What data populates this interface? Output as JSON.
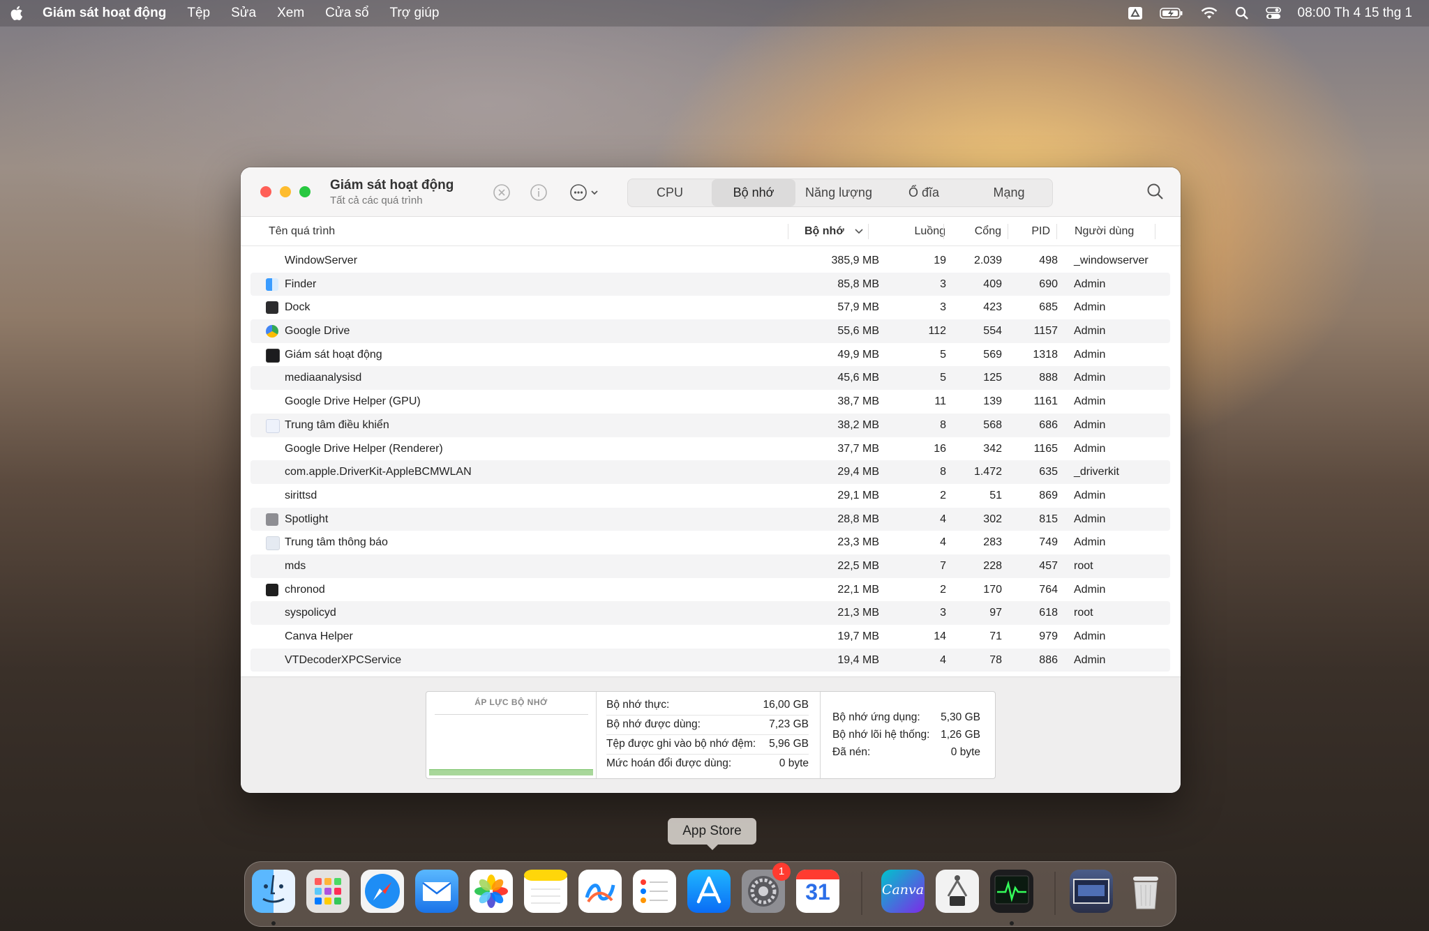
{
  "menubar": {
    "app_name": "Giám sát hoạt động",
    "menus": [
      "Tệp",
      "Sửa",
      "Xem",
      "Cửa sổ",
      "Trợ giúp"
    ],
    "clock": "08:00 Th 4 15 thg 1"
  },
  "window": {
    "title": "Giám sát hoạt động",
    "subtitle": "Tất cả các quá trình",
    "tabs": [
      "CPU",
      "Bộ nhớ",
      "Năng lượng",
      "Ổ đĩa",
      "Mạng"
    ],
    "active_tab": "Bộ nhớ",
    "columns": {
      "name": "Tên quá trình",
      "memory": "Bộ nhớ",
      "threads": "Luồng",
      "ports": "Cổng",
      "pid": "PID",
      "user": "Người dùng"
    },
    "processes": [
      {
        "name": "WindowServer",
        "memory": "385,9 MB",
        "threads": "19",
        "ports": "2.039",
        "pid": "498",
        "user": "_windowserver",
        "icon": ""
      },
      {
        "name": "Finder",
        "memory": "85,8 MB",
        "threads": "3",
        "ports": "409",
        "pid": "690",
        "user": "Admin",
        "icon": "finder"
      },
      {
        "name": "Dock",
        "memory": "57,9 MB",
        "threads": "3",
        "ports": "423",
        "pid": "685",
        "user": "Admin",
        "icon": "dock"
      },
      {
        "name": "Google Drive",
        "memory": "55,6 MB",
        "threads": "112",
        "ports": "554",
        "pid": "1157",
        "user": "Admin",
        "icon": "gdrive"
      },
      {
        "name": "Giám sát hoạt động",
        "memory": "49,9 MB",
        "threads": "5",
        "ports": "569",
        "pid": "1318",
        "user": "Admin",
        "icon": "activity"
      },
      {
        "name": "mediaanalysisd",
        "memory": "45,6 MB",
        "threads": "5",
        "ports": "125",
        "pid": "888",
        "user": "Admin",
        "icon": ""
      },
      {
        "name": "Google Drive Helper (GPU)",
        "memory": "38,7 MB",
        "threads": "11",
        "ports": "139",
        "pid": "1161",
        "user": "Admin",
        "icon": ""
      },
      {
        "name": "Trung tâm điều khiển",
        "memory": "38,2 MB",
        "threads": "8",
        "ports": "568",
        "pid": "686",
        "user": "Admin",
        "icon": "control"
      },
      {
        "name": "Google Drive Helper (Renderer)",
        "memory": "37,7 MB",
        "threads": "16",
        "ports": "342",
        "pid": "1165",
        "user": "Admin",
        "icon": ""
      },
      {
        "name": "com.apple.DriverKit-AppleBCMWLAN",
        "memory": "29,4 MB",
        "threads": "8",
        "ports": "1.472",
        "pid": "635",
        "user": "_driverkit",
        "icon": ""
      },
      {
        "name": "sirittsd",
        "memory": "29,1 MB",
        "threads": "2",
        "ports": "51",
        "pid": "869",
        "user": "Admin",
        "icon": ""
      },
      {
        "name": "Spotlight",
        "memory": "28,8 MB",
        "threads": "4",
        "ports": "302",
        "pid": "815",
        "user": "Admin",
        "icon": "spotlight"
      },
      {
        "name": "Trung tâm thông báo",
        "memory": "23,3 MB",
        "threads": "4",
        "ports": "283",
        "pid": "749",
        "user": "Admin",
        "icon": "notif"
      },
      {
        "name": "mds",
        "memory": "22,5 MB",
        "threads": "7",
        "ports": "228",
        "pid": "457",
        "user": "root",
        "icon": ""
      },
      {
        "name": "chronod",
        "memory": "22,1 MB",
        "threads": "2",
        "ports": "170",
        "pid": "764",
        "user": "Admin",
        "icon": "terminal"
      },
      {
        "name": "syspolicyd",
        "memory": "21,3 MB",
        "threads": "3",
        "ports": "97",
        "pid": "618",
        "user": "root",
        "icon": ""
      },
      {
        "name": "Canva Helper",
        "memory": "19,7 MB",
        "threads": "14",
        "ports": "71",
        "pid": "979",
        "user": "Admin",
        "icon": ""
      },
      {
        "name": "VTDecoderXPCService",
        "memory": "19,4 MB",
        "threads": "4",
        "ports": "78",
        "pid": "886",
        "user": "Admin",
        "icon": ""
      }
    ],
    "memory_panel": {
      "pressure_label": "ÁP LỰC BỘ NHỚ",
      "pressure_fraction": 0.1,
      "physical_label": "Bộ nhớ thực:",
      "physical_value": "16,00 GB",
      "used_label": "Bộ nhớ được dùng:",
      "used_value": "7,23 GB",
      "cached_label": "Tệp được ghi vào bộ nhớ đệm:",
      "cached_value": "5,96 GB",
      "swap_label": "Mức hoán đổi được dùng:",
      "swap_value": "0 byte",
      "app_label": "Bộ nhớ ứng dụng:",
      "app_value": "5,30 GB",
      "wired_label": "Bộ nhớ lõi hệ thống:",
      "wired_value": "1,26 GB",
      "compressed_label": "Đã nén:",
      "compressed_value": "0 byte"
    }
  },
  "tooltip": "App Store",
  "dock": {
    "badge_settings": "1",
    "calendar_day": "31",
    "canva_label": "Canva"
  },
  "colors": {
    "close": "#ff5f57",
    "minimize": "#febc2e",
    "maximize": "#28c840",
    "pressure_green": "#a8d79a"
  }
}
